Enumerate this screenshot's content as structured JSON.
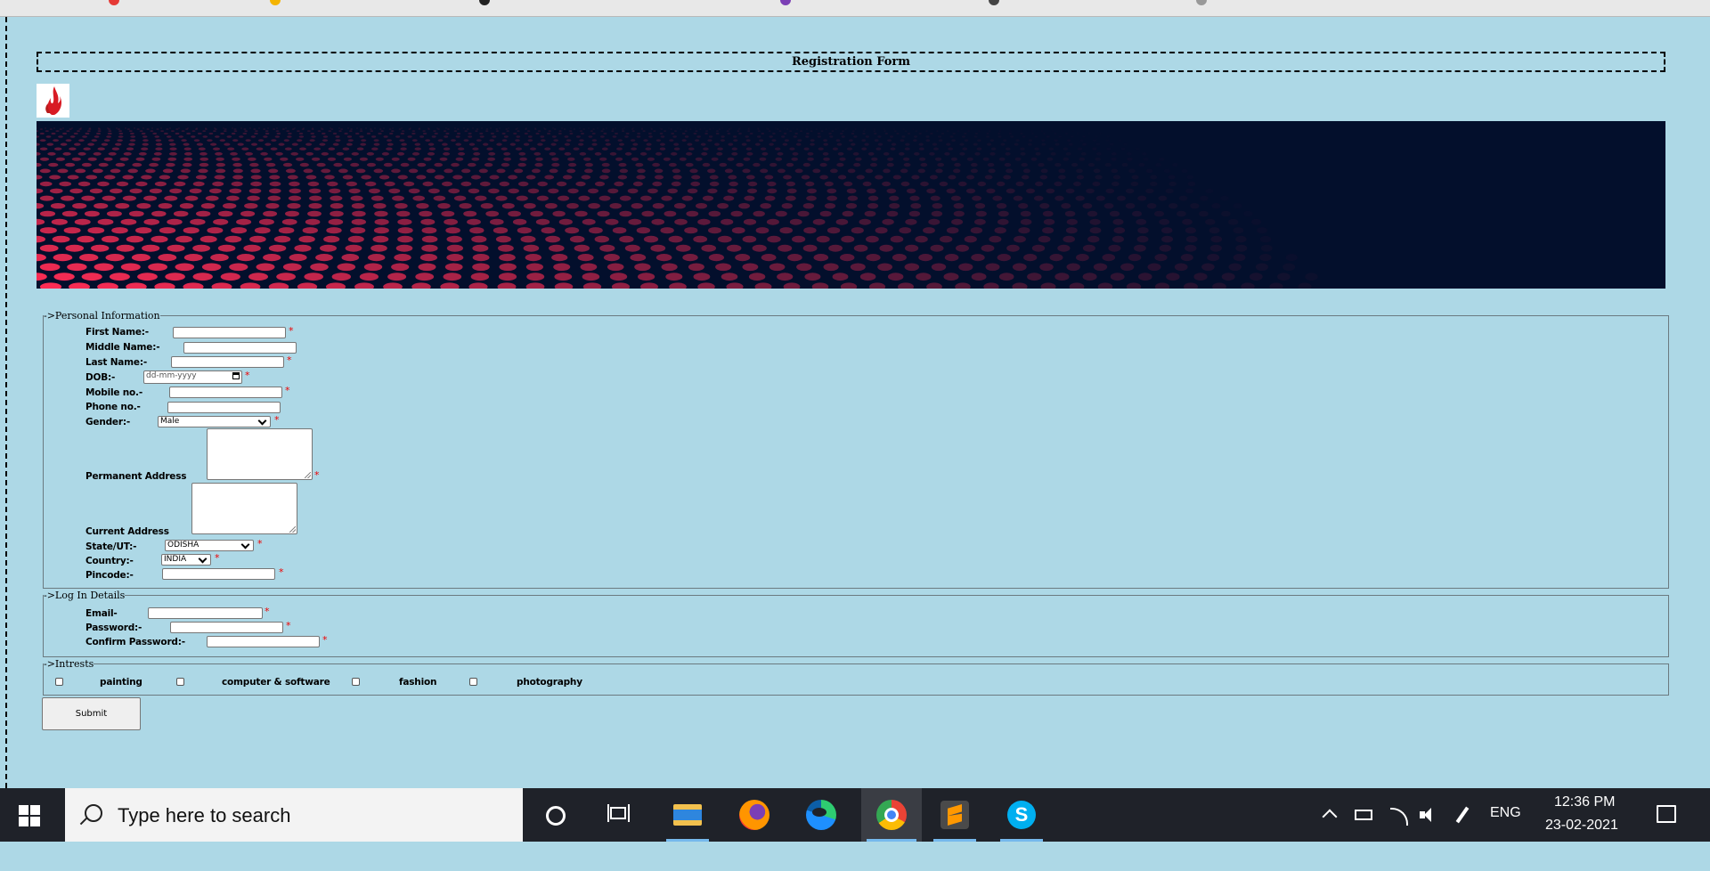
{
  "form": {
    "title": "Registration Form",
    "personal": {
      "legend": "->Personal Information",
      "first_name": "First Name:-",
      "middle_name": "Middle Name:-",
      "last_name": "Last Name:-",
      "dob": "DOB:-",
      "dob_placeholder": "dd-mm-yyyy",
      "mobile": "Mobile no.-",
      "phone": "Phone no.-",
      "gender": "Gender:-",
      "gender_value": "Male",
      "permanent_address": "Permanent Address",
      "current_address": "Current Address",
      "state": "State/UT:-",
      "state_value": "ODISHA",
      "country": "Country:-",
      "country_value": "INDIA",
      "pincode": "Pincode:-"
    },
    "login": {
      "legend": "->Log In Details",
      "email": "Email-",
      "password": "Password:-",
      "confirm_password": "Confirm Password:-"
    },
    "interests": {
      "legend": "->Intrests",
      "items": [
        "painting",
        "computer & software",
        "fashion",
        "photography"
      ]
    },
    "required_mark": "*",
    "submit_label": "Submit"
  },
  "taskbar": {
    "search_placeholder": "Type here to search",
    "language": "ENG",
    "time": "12:36 PM",
    "date": "23-02-2021",
    "apps": [
      "cortana-icon",
      "task-view-icon",
      "file-explorer-icon",
      "firefox-icon",
      "edge-icon",
      "chrome-icon",
      "sublime-text-icon",
      "skype-icon"
    ]
  }
}
